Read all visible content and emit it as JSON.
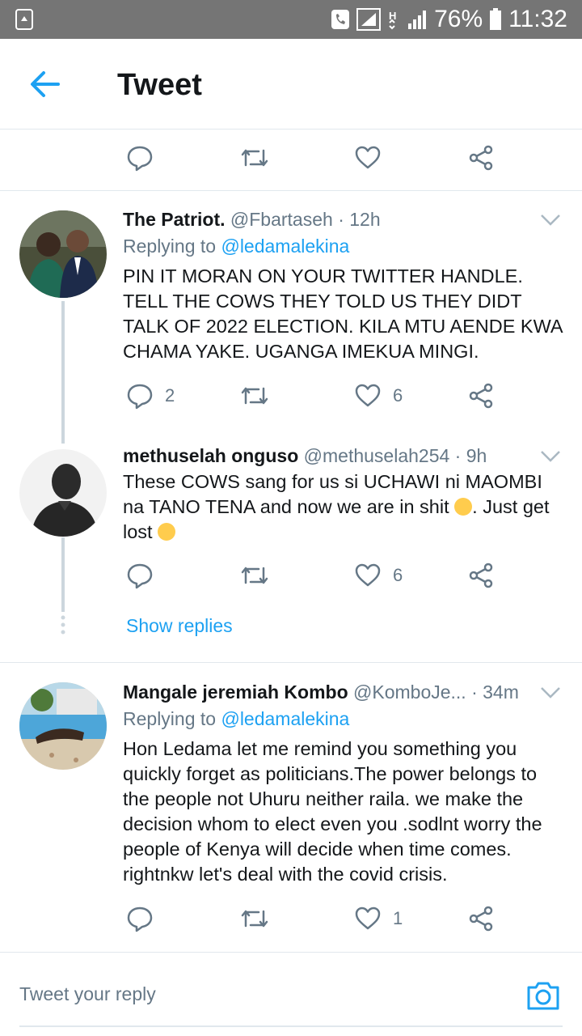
{
  "status_bar": {
    "battery": "76%",
    "time": "11:32",
    "icons": [
      "recycle-icon",
      "phone-icon",
      "signal-icon",
      "h-plus-icon",
      "signal-icon",
      "battery-icon"
    ]
  },
  "header": {
    "title": "Tweet",
    "back_icon": "arrow-left-icon"
  },
  "tweets": [
    {
      "name": "The Patriot.",
      "handle": "@Fbartaseh",
      "time": "· 12h",
      "replying_label": "Replying to",
      "replying_to": "@ledamalekina",
      "text": "PIN IT MORAN ON YOUR TWITTER HANDLE. TELL THE COWS THEY TOLD US THEY DIDT TALK OF 2022  ELECTION. KILA MTU AENDE KWA CHAMA YAKE.  UGANGA IMEKUA MINGI.",
      "replies": "2",
      "retweets": "",
      "likes": "6"
    },
    {
      "name": "methuselah onguso",
      "handle": "@methuselah254",
      "time": "· 9h",
      "text_part1": "These COWS sang for us si UCHAWI ni  MAOMBI na TANO TENA and now we are in shit ",
      "text_part2": ". Just get lost ",
      "replies": "",
      "retweets": "",
      "likes": "6"
    },
    {
      "name": "Mangale jeremiah Kombo",
      "handle": "@KomboJe...",
      "time": "· 34m",
      "replying_label": "Replying to",
      "replying_to": "@ledamalekina",
      "text": "Hon Ledama let me remind you something you quickly forget as politicians.The power belongs to the people not Uhuru neither raila. we make the decision whom to elect even you .sodlnt worry the people of Kenya will decide when time comes. rightnkw let's deal with the covid crisis.",
      "replies": "",
      "retweets": "",
      "likes": "1"
    }
  ],
  "show_replies": "Show replies",
  "reply_bar": {
    "placeholder": "Tweet your reply",
    "camera_icon": "camera-icon"
  },
  "colors": {
    "accent": "#1da1f2",
    "muted": "#657786",
    "divider": "#e1e8ed",
    "status_bar": "#757575"
  }
}
